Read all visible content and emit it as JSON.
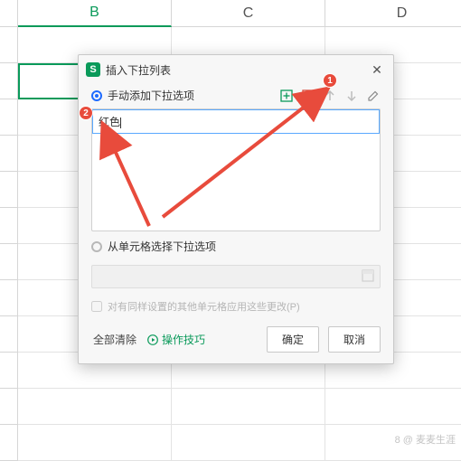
{
  "columns": {
    "A": "",
    "B": "B",
    "C": "C",
    "D": "D"
  },
  "dialog": {
    "app_letter": "S",
    "title": "插入下拉列表",
    "close": "✕",
    "manual_label": "手动添加下拉选项",
    "item_value": "红色",
    "from_range_label": "从单元格选择下拉选项",
    "apply_same_label": "对有同样设置的其他单元格应用这些更改(P)",
    "clear_all": "全部清除",
    "tips": "操作技巧",
    "ok": "确定",
    "cancel": "取消"
  },
  "annotations": {
    "b1": "1",
    "b2": "2"
  },
  "watermark": "8 @ 麦麦生涯"
}
